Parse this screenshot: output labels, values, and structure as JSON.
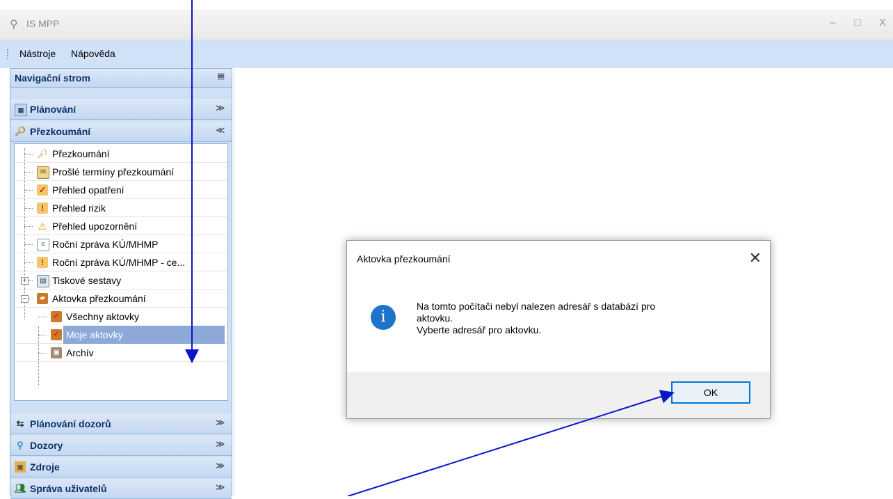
{
  "window": {
    "title": "IS MPP",
    "minimize": "–",
    "maximize": "□",
    "close": "X"
  },
  "menu": {
    "items": [
      "Nástroje",
      "Nápověda"
    ]
  },
  "nav": {
    "header": "Navigační strom",
    "pin": "ꟷ",
    "sections_top": [
      {
        "label": "Plánování",
        "chevron": "≫",
        "icon": "calendar-icon"
      },
      {
        "label": "Přezkoumání",
        "chevron": "≪",
        "icon": "search-doc-icon"
      }
    ],
    "tree": [
      {
        "label": "Přezkoumání",
        "icon": "search-doc-icon"
      },
      {
        "label": "Prošlé termíny přezkoumání",
        "icon": "envelope-icon"
      },
      {
        "label": "Přehled opatření",
        "icon": "checkbox-icon"
      },
      {
        "label": "Přehled rizik",
        "icon": "folder-warning-icon"
      },
      {
        "label": "Přehled upozornění",
        "icon": "warning-icon"
      },
      {
        "label": "Roční zpráva KÚ/MHMP",
        "icon": "report-icon"
      },
      {
        "label": "Roční zpráva KÚ/MHMP - ce...",
        "icon": "folder-warning-icon"
      },
      {
        "label": "Tiskové sestavy",
        "icon": "printer-icon"
      },
      {
        "label": "Aktovka přezkoumání",
        "icon": "briefcase-icon"
      },
      {
        "label": "Všechny aktovky",
        "icon": "briefcase-check-icon"
      },
      {
        "label": "Moje aktovky",
        "icon": "briefcase-check-icon"
      },
      {
        "label": "Archív",
        "icon": "archive-icon"
      }
    ],
    "sections_bottom": [
      {
        "label": "Plánování dozorů",
        "chevron": "≫",
        "icon": "handshake-icon"
      },
      {
        "label": "Dozory",
        "chevron": "≫",
        "icon": "magnifier-icon"
      },
      {
        "label": "Zdroje",
        "chevron": "≫",
        "icon": "resources-icon"
      },
      {
        "label": "Správa uživatelů",
        "chevron": "≫",
        "icon": "users-icon"
      }
    ],
    "selected": "Moje aktovky"
  },
  "dialog": {
    "title": "Aktovka přezkoumání",
    "close": "✕",
    "info_glyph": "i",
    "message_line1": "Na tomto počítači nebyl nalezen adresář s databází pro",
    "message_line2": "aktovku.",
    "message_line3": "Vyberte adresář pro aktovku.",
    "ok_label": "OK"
  },
  "colors": {
    "arrow": "#0a14c8",
    "accent": "#0078d7",
    "selection": "#8da9d8",
    "info": "#1e75c7"
  }
}
